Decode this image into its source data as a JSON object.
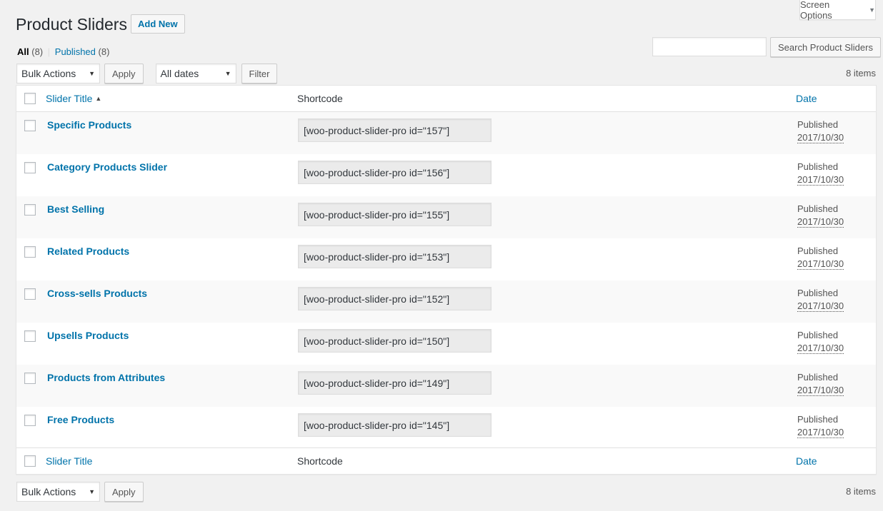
{
  "screen_options": {
    "label": "Screen Options"
  },
  "page": {
    "title": "Product Sliders",
    "add_new": "Add New"
  },
  "filters": {
    "all_label": "All",
    "all_count": "(8)",
    "separator": "|",
    "published_label": "Published",
    "published_count": "(8)"
  },
  "search": {
    "button": "Search Product Sliders",
    "value": ""
  },
  "tablenav": {
    "bulk_actions": "Bulk Actions",
    "apply": "Apply",
    "dates": "All dates",
    "filter": "Filter",
    "items_count": "8 items"
  },
  "table": {
    "columns": {
      "title": "Slider Title",
      "shortcode": "Shortcode",
      "date": "Date"
    },
    "rows": [
      {
        "title": "Specific Products",
        "shortcode": "[woo-product-slider-pro id=\"157\"]",
        "status": "Published",
        "date": "2017/10/30"
      },
      {
        "title": "Category Products Slider",
        "shortcode": "[woo-product-slider-pro id=\"156\"]",
        "status": "Published",
        "date": "2017/10/30"
      },
      {
        "title": "Best Selling",
        "shortcode": "[woo-product-slider-pro id=\"155\"]",
        "status": "Published",
        "date": "2017/10/30"
      },
      {
        "title": "Related Products",
        "shortcode": "[woo-product-slider-pro id=\"153\"]",
        "status": "Published",
        "date": "2017/10/30"
      },
      {
        "title": "Cross-sells Products",
        "shortcode": "[woo-product-slider-pro id=\"152\"]",
        "status": "Published",
        "date": "2017/10/30"
      },
      {
        "title": "Upsells Products",
        "shortcode": "[woo-product-slider-pro id=\"150\"]",
        "status": "Published",
        "date": "2017/10/30"
      },
      {
        "title": "Products from Attributes",
        "shortcode": "[woo-product-slider-pro id=\"149\"]",
        "status": "Published",
        "date": "2017/10/30"
      },
      {
        "title": "Free Products",
        "shortcode": "[woo-product-slider-pro id=\"145\"]",
        "status": "Published",
        "date": "2017/10/30"
      }
    ]
  },
  "icons": {
    "sort": "caret-up-icon",
    "dropdown": "caret-down-icon"
  },
  "colors": {
    "link": "#0073aa",
    "background": "#f1f1f1",
    "alt_row": "#f9f9f9"
  }
}
